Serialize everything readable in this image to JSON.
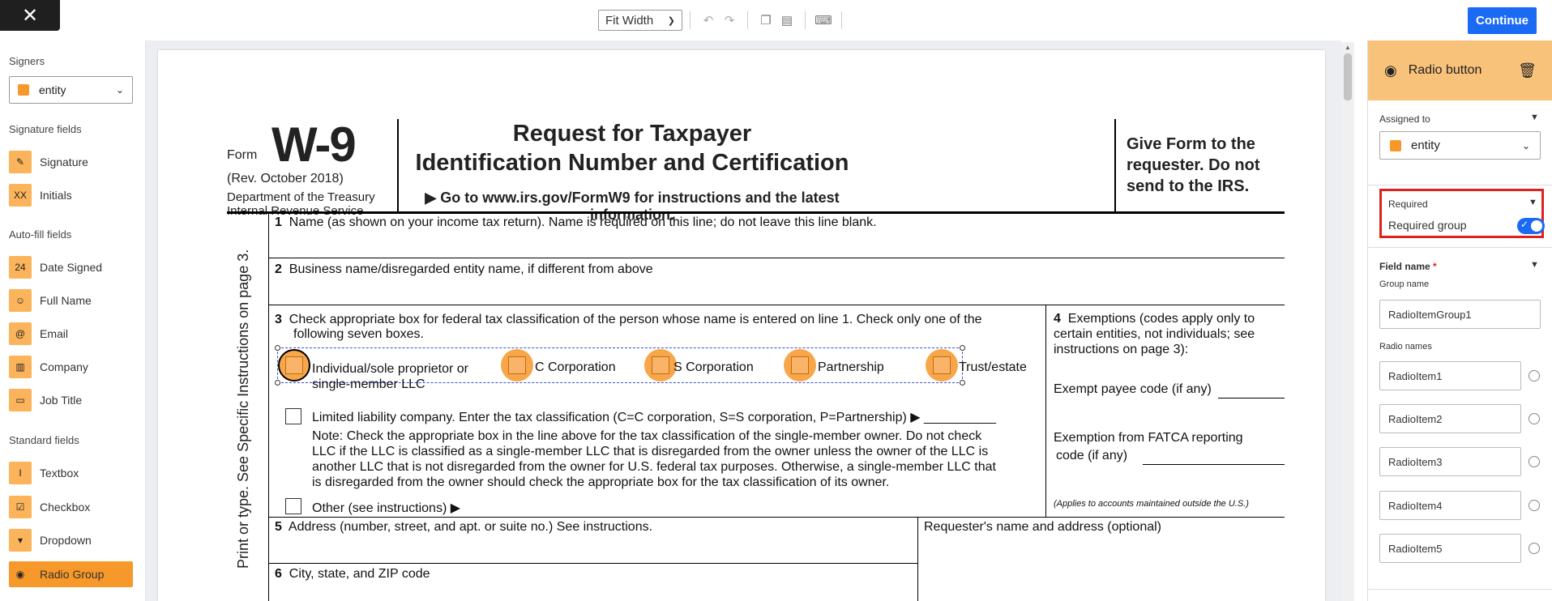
{
  "toolbar": {
    "zoom": "Fit Width",
    "continue_label": "Continue"
  },
  "sidebar": {
    "signers_title": "Signers",
    "signer_selected": "entity",
    "signature_title": "Signature fields",
    "signature_items": [
      "Signature",
      "Initials"
    ],
    "autofill_title": "Auto-fill fields",
    "autofill_items": [
      "Date Signed",
      "Full Name",
      "Email",
      "Company",
      "Job Title"
    ],
    "standard_title": "Standard fields",
    "standard_items": [
      "Textbox",
      "Checkbox",
      "Dropdown",
      "Radio Group"
    ],
    "accent_color": "#f7982a"
  },
  "document": {
    "form_word": "Form",
    "form_number": "W-9",
    "rev": "(Rev. October 2018)",
    "dept_line1": "Department of the Treasury",
    "dept_line2": "Internal Revenue Service",
    "title_line1": "Request for Taxpayer",
    "title_line2": "Identification Number and Certification",
    "goto": "▶ Go to www.irs.gov/FormW9 for instructions and the latest information.",
    "give_line1": "Give Form to the",
    "give_line2": "requester. Do not",
    "give_line3": "send to the IRS.",
    "vertical_text": "Print or type.   See Specific Instructions on page 3.",
    "line1": "Name (as shown on your income tax return). Name is required on this line; do not leave this line blank.",
    "line2": "Business name/disregarded entity name, if different from above",
    "line3a": "Check appropriate box for federal tax classification of the person whose name is entered on line 1. Check only one of the",
    "line3b": "following seven boxes.",
    "opt_individual_1": "Individual/sole proprietor or",
    "opt_individual_2": "single-member LLC",
    "opt_c": "C Corporation",
    "opt_s": "S Corporation",
    "opt_partnership": "Partnership",
    "opt_trust": "Trust/estate",
    "llc_line": "Limited liability company. Enter the tax classification (C=C corporation, S=S corporation, P=Partnership) ▶ __________",
    "note_1": "Note: Check the appropriate box in the line above for the tax classification of the single-member owner.  Do not check",
    "note_2": "LLC if the LLC is classified as a single-member LLC that is disregarded from the owner unless the owner of the LLC is",
    "note_3": "another LLC that is not disregarded from the owner for U.S. federal tax purposes. Otherwise, a single-member LLC that",
    "note_4": "is disregarded from the owner should check the appropriate box for the tax classification of its owner.",
    "other": "Other (see instructions) ▶",
    "line4a": "Exemptions (codes apply only to",
    "line4b": "certain entities, not individuals; see",
    "line4c": "instructions on page 3):",
    "exempt_payee": "Exempt payee code (if any)",
    "fatca_1": "Exemption from FATCA reporting",
    "fatca_2": "code (if any)",
    "applies": "(Applies to accounts maintained outside the U.S.)",
    "line5": "Address (number, street, and apt. or suite no.) See instructions.",
    "requester": "Requester's name and address (optional)",
    "line6": "City, state, and ZIP code"
  },
  "panel": {
    "header": "Radio button",
    "assigned_label": "Assigned to",
    "assigned_value": "entity",
    "required_label": "Required",
    "required_group_label": "Required group",
    "required_group_on": true,
    "field_name_label": "Field name",
    "required_star": "*",
    "group_name_label": "Group name",
    "group_name_value": "RadioItemGroup1",
    "radio_names_label": "Radio names",
    "radio_names": [
      "RadioItem1",
      "RadioItem2",
      "RadioItem3",
      "RadioItem4",
      "RadioItem5"
    ],
    "header_color": "#f9c27a",
    "highlight_color": "#e02020"
  }
}
